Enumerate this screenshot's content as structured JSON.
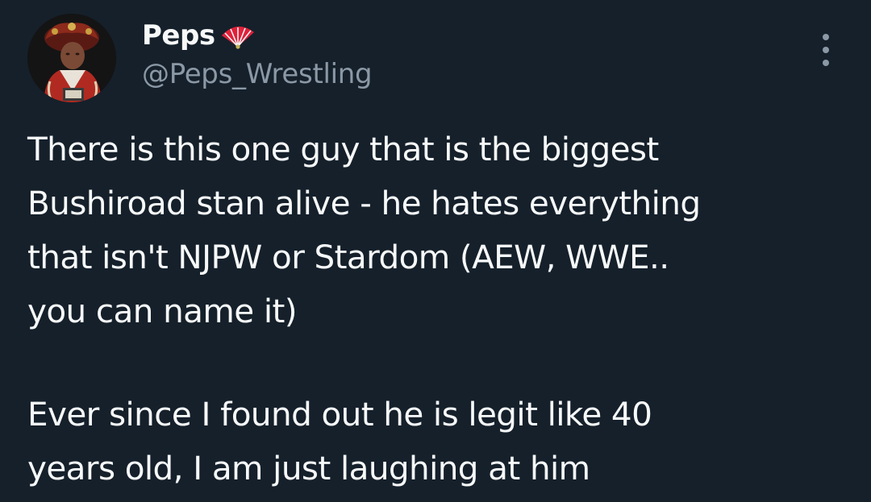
{
  "colors": {
    "background": "#15202b",
    "text_primary": "#f7f9f9",
    "text_secondary": "#8b98a5",
    "fan_accent": "#e0213a"
  },
  "author": {
    "display_name": "Peps",
    "badge_icon": "red-folding-fan-icon",
    "handle": "@Peps_Wrestling",
    "avatar_icon": "profile-avatar"
  },
  "menu": {
    "icon": "more-vertical-icon"
  },
  "tweet": {
    "paragraph_1": "There is this one guy that is the biggest\nBushiroad stan alive - he hates everything\nthat isn't NJPW or Stardom (AEW, WWE..\nyou can name it)",
    "paragraph_2": "Ever since I found out he is legit like 40\nyears old, I am just laughing at him"
  }
}
